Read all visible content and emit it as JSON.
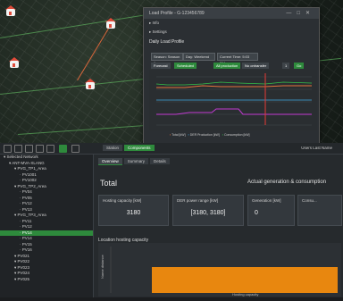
{
  "map": {
    "pins": [
      "house-pin",
      "house-pin",
      "house-pin",
      "house-pin"
    ]
  },
  "dialog": {
    "title": "Load Profile - G-123456789",
    "rows": [
      "Info",
      "Settings"
    ],
    "section": "Daily Load Profile",
    "season_label": "Season: Season 1",
    "day_label": "Day: Weekend",
    "time_label": "Current Time: 5:03 PM",
    "button_forecast": "Forecast",
    "button_scheduled": "Scheduled",
    "button_all_production": "All production",
    "button_no_ontransfer": "No ontransfer",
    "counter": "1",
    "button_go": "Go"
  },
  "chart1": {
    "legend": [
      "Total [kW]",
      "DER Production [kW]",
      "Consumption [kW]",
      "Total [kWh]",
      "DER Production [kWh]",
      "Consumption [kWh]"
    ],
    "colors": [
      "#e8733c",
      "#3fa8e0",
      "#35c04a",
      "#c13bd1"
    ]
  },
  "toolbar": {
    "tab_station": "Station",
    "tab_components": "Components",
    "right_text": "Users Last Name"
  },
  "tree": {
    "items": [
      {
        "label": "Selected Network",
        "indent": 0,
        "selected": false
      },
      {
        "label": "ANT-MVA-XLANG",
        "indent": 1,
        "selected": false
      },
      {
        "label": "PVG_TP1_Area",
        "indent": 2,
        "selected": false
      },
      {
        "label": "PV1001",
        "indent": 3,
        "selected": false
      },
      {
        "label": "PV1002",
        "indent": 3,
        "selected": false
      },
      {
        "label": "PVG_TP2_Area",
        "indent": 2,
        "selected": false
      },
      {
        "label": "PV04",
        "indent": 3,
        "selected": false
      },
      {
        "label": "PV05",
        "indent": 3,
        "selected": false
      },
      {
        "label": "PV12",
        "indent": 3,
        "selected": false
      },
      {
        "label": "PV13",
        "indent": 3,
        "selected": false
      },
      {
        "label": "PVG_TP3_Area",
        "indent": 2,
        "selected": false
      },
      {
        "label": "PV11",
        "indent": 3,
        "selected": false
      },
      {
        "label": "PV12",
        "indent": 3,
        "selected": false
      },
      {
        "label": "PV14",
        "indent": 3,
        "selected": true
      },
      {
        "label": "PV14",
        "indent": 3,
        "selected": false
      },
      {
        "label": "PV15",
        "indent": 3,
        "selected": false
      },
      {
        "label": "PV16",
        "indent": 3,
        "selected": false
      },
      {
        "label": "PV021",
        "indent": 2,
        "selected": false
      },
      {
        "label": "PV022",
        "indent": 2,
        "selected": false
      },
      {
        "label": "PV023",
        "indent": 2,
        "selected": false
      },
      {
        "label": "PV024",
        "indent": 2,
        "selected": false
      },
      {
        "label": "PV025",
        "indent": 2,
        "selected": false
      }
    ]
  },
  "main": {
    "subtabs": [
      "Overview",
      "Summary",
      "Details"
    ],
    "title": "Total",
    "actual_title": "Actual generation & consumption",
    "card_hosting_label": "Hosting capacity [kW]",
    "card_hosting_value": "3180",
    "card_der_label": "DER power range [kW]",
    "card_der_value": "[3180, 3180]",
    "card_gen_label": "Generation [kW]",
    "card_gen_value": "0",
    "card_cons_label": "Consu...",
    "loc_title": "Location hosting capacity",
    "chart2_ylabel": "Name distance",
    "chart2_xlabel": "Hosting capacity"
  }
}
